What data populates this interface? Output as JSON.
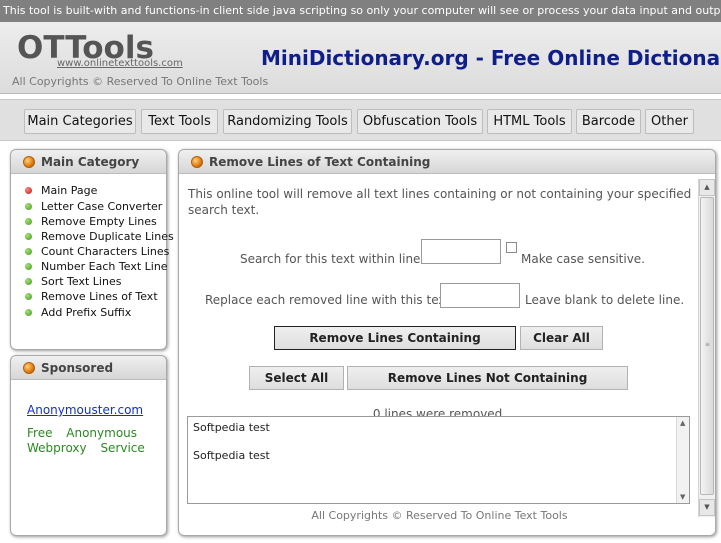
{
  "notice": "This tool is built-with and functions-in client side java scripting so only your computer will see or process your data input and output.",
  "header": {
    "logo": "OTTools",
    "logo_url": "www.onlinetexttools.com",
    "copyright": "All Copyrights © Reserved To Online Text Tools",
    "site_title": "MiniDictionary.org - Free Online Dictionary"
  },
  "nav": [
    "Main Categories",
    "Text Tools",
    "Randomizing Tools",
    "Obfuscation Tools",
    "HTML Tools",
    "Barcode",
    "Other"
  ],
  "sidebar": {
    "title": "Main Category",
    "items": [
      "Main Page",
      "Letter Case Converter",
      "Remove Empty Lines",
      "Remove Duplicate Lines",
      "Count Characters Lines",
      "Number Each Text Line",
      "Sort Text Lines",
      "Remove Lines of Text",
      "Add Prefix Suffix"
    ]
  },
  "sponsored": {
    "title": "Sponsored",
    "link": "Anonymouster.com",
    "text": "Free Anonymous Webproxy Service"
  },
  "tool": {
    "title": "Remove Lines of Text Containing",
    "intro": "This online tool will remove all text lines containing or not containing your specified search text.",
    "search_label": "Search for this text within lines",
    "case_label": "Make case sensitive.",
    "replace_label": "Replace each removed line with this text",
    "blank_label": "Leave blank to delete line.",
    "btn_remove_containing": "Remove Lines Containing",
    "btn_clear_all": "Clear All",
    "btn_select_all": "Select All",
    "btn_remove_not_containing": "Remove Lines Not Containing",
    "status": "0 lines were removed.",
    "text_lines": [
      "Softpedia test",
      "Softpedia test"
    ],
    "footer": "All Copyrights © Reserved To Online Text Tools"
  },
  "icons": {
    "panel_orb": "orange-orb-icon",
    "menu_bullet": "green-dot-icon",
    "menu_bullet_active": "red-dot-icon"
  },
  "colors": {
    "site_title": "#0f1f8a",
    "link": "#1a2fb8",
    "ad_text": "#2a8a20",
    "notice_bg": "#808080"
  }
}
